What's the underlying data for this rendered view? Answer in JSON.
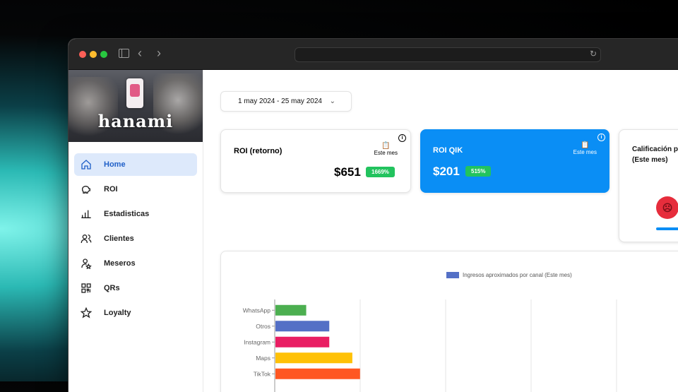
{
  "brand": {
    "logo_text": "hanami"
  },
  "sidebar": {
    "items": [
      {
        "label": "Home",
        "icon": "home-icon",
        "active": true
      },
      {
        "label": "ROI",
        "icon": "piggy-bank-icon",
        "active": false
      },
      {
        "label": "Estadisticas",
        "icon": "bar-chart-icon",
        "active": false
      },
      {
        "label": "Clientes",
        "icon": "users-icon",
        "active": false
      },
      {
        "label": "Meseros",
        "icon": "waiter-icon",
        "active": false
      },
      {
        "label": "QRs",
        "icon": "qr-code-icon",
        "active": false
      },
      {
        "label": "Loyalty",
        "icon": "star-icon",
        "active": false
      }
    ]
  },
  "date_range": {
    "label": "1 may 2024 - 25 may 2024"
  },
  "cards": {
    "roi": {
      "title": "ROI (retorno)",
      "period": "Este mes",
      "amount": "$651",
      "badge": "1669%"
    },
    "qik": {
      "title": "ROI QIK",
      "period": "Este mes",
      "amount": "$201",
      "badge": "515%"
    },
    "calificacion": {
      "title_line1": "Calificación pr",
      "title_line2": "(Este mes)"
    }
  },
  "colors": {
    "accent": "#0a8ef5",
    "active_nav_bg": "#dde9fb",
    "badge": "#22c35e",
    "sad_face": "#e62d3c"
  },
  "chart_data": {
    "type": "bar",
    "orientation": "horizontal",
    "legend": "Ingresos aproximados por canal (Este mes)",
    "categories": [
      "WhatsApp",
      "Otros",
      "Instagram",
      "Maps",
      "TikTok"
    ],
    "values": [
      36,
      63,
      63,
      90,
      99
    ],
    "colors": [
      "#4caf50",
      "#5470c6",
      "#e91e63",
      "#ffc107",
      "#ff5722"
    ],
    "xlim": [
      0,
      400
    ],
    "grid": true
  }
}
